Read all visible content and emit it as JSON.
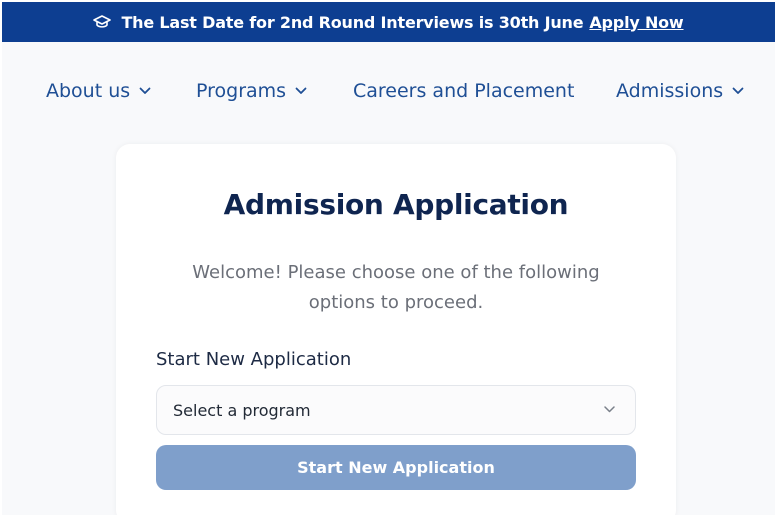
{
  "announcement": {
    "text": "The Last Date for 2nd Round Interviews is 30th June",
    "link": "Apply Now",
    "icon": "graduation-cap-icon",
    "bg": "#0d3e91"
  },
  "nav": {
    "items": [
      {
        "label": "About us",
        "has_dropdown": true
      },
      {
        "label": "Programs",
        "has_dropdown": true
      },
      {
        "label": "Careers and Placement",
        "has_dropdown": false
      },
      {
        "label": "Admissions",
        "has_dropdown": true
      }
    ],
    "color": "#1f4f95"
  },
  "card": {
    "title": "Admission Application",
    "welcome": "Welcome! Please choose one of the following options to proceed.",
    "section_label": "Start New Application",
    "select": {
      "value": "Select a program",
      "icon": "chevron-down-icon"
    },
    "button": {
      "label": "Start New Application",
      "color": "#7f9fcb"
    }
  }
}
